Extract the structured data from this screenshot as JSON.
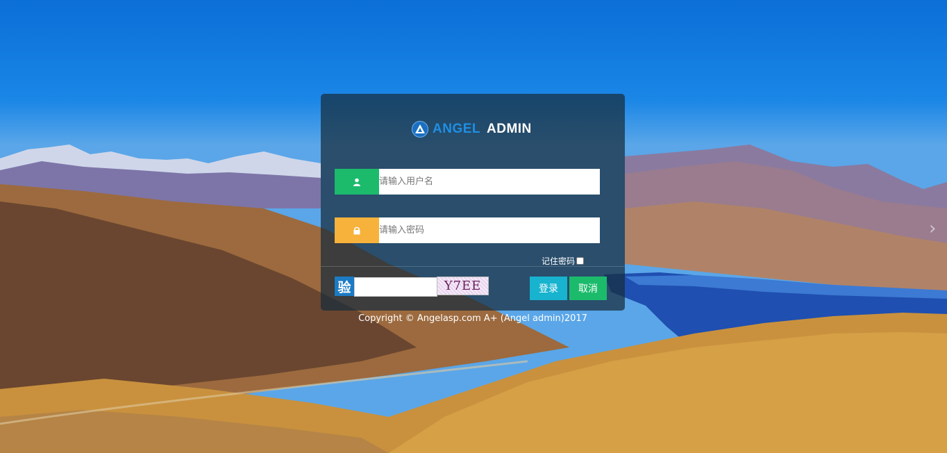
{
  "background": {
    "description_icon": "landscape-photo",
    "next_arrow": "›"
  },
  "logo": {
    "mark_icon": "angel-logo-icon",
    "brand_part1": "ANGEL",
    "brand_part2": "ADMIN",
    "brand_color": "#1f8fe3"
  },
  "login": {
    "username_icon": "user-icon",
    "username_placeholder": "请输入用户名",
    "username_value": "",
    "password_icon": "lock-icon",
    "password_placeholder": "请输入密码",
    "password_value": "",
    "remember_label": "记住密码",
    "remember_checked": false,
    "captcha_label": "验",
    "captcha_value": "",
    "captcha_image_text": "Y7EE",
    "login_button": "登录",
    "cancel_button": "取消",
    "login_color": "#17b3cf",
    "cancel_color": "#1cbb6c",
    "username_icon_color": "#1cbb6c",
    "password_icon_color": "#f7b23c"
  },
  "footer": {
    "copyright": "Copyright © Angelasp.com A+ (Angel admin)2017"
  }
}
